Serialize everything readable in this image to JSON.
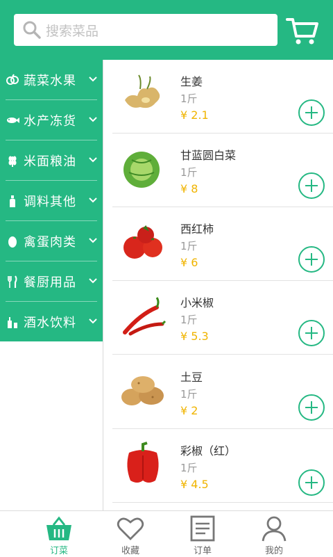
{
  "search": {
    "placeholder": "搜索菜品"
  },
  "sidebar": {
    "categories": [
      {
        "label": "蔬菜水果",
        "icon": "vegetable-icon"
      },
      {
        "label": "水产冻货",
        "icon": "fish-icon"
      },
      {
        "label": "米面粮油",
        "icon": "grain-icon"
      },
      {
        "label": "调料其他",
        "icon": "seasoning-bottle-icon"
      },
      {
        "label": "禽蛋肉类",
        "icon": "egg-icon"
      },
      {
        "label": "餐厨用品",
        "icon": "utensils-icon"
      },
      {
        "label": "酒水饮料",
        "icon": "drinks-icon"
      }
    ]
  },
  "products": [
    {
      "name": "生姜",
      "unit": "1斤",
      "price": "¥ 2.1"
    },
    {
      "name": "甘蓝圆白菜",
      "unit": "1斤",
      "price": "¥ 8"
    },
    {
      "name": "西红柿",
      "unit": "1斤",
      "price": "¥ 6"
    },
    {
      "name": "小米椒",
      "unit": "1斤",
      "price": "¥ 5.3"
    },
    {
      "name": "土豆",
      "unit": "1斤",
      "price": "¥ 2"
    },
    {
      "name": "彩椒（红）",
      "unit": "1斤",
      "price": "¥ 4.5"
    }
  ],
  "bottom_nav": [
    {
      "label": "订菜",
      "icon": "basket-icon",
      "active": true
    },
    {
      "label": "收藏",
      "icon": "heart-icon",
      "active": false
    },
    {
      "label": "订单",
      "icon": "order-list-icon",
      "active": false
    },
    {
      "label": "我的",
      "icon": "user-icon",
      "active": false
    }
  ],
  "colors": {
    "accent": "#25b883",
    "price": "#f0b400"
  }
}
